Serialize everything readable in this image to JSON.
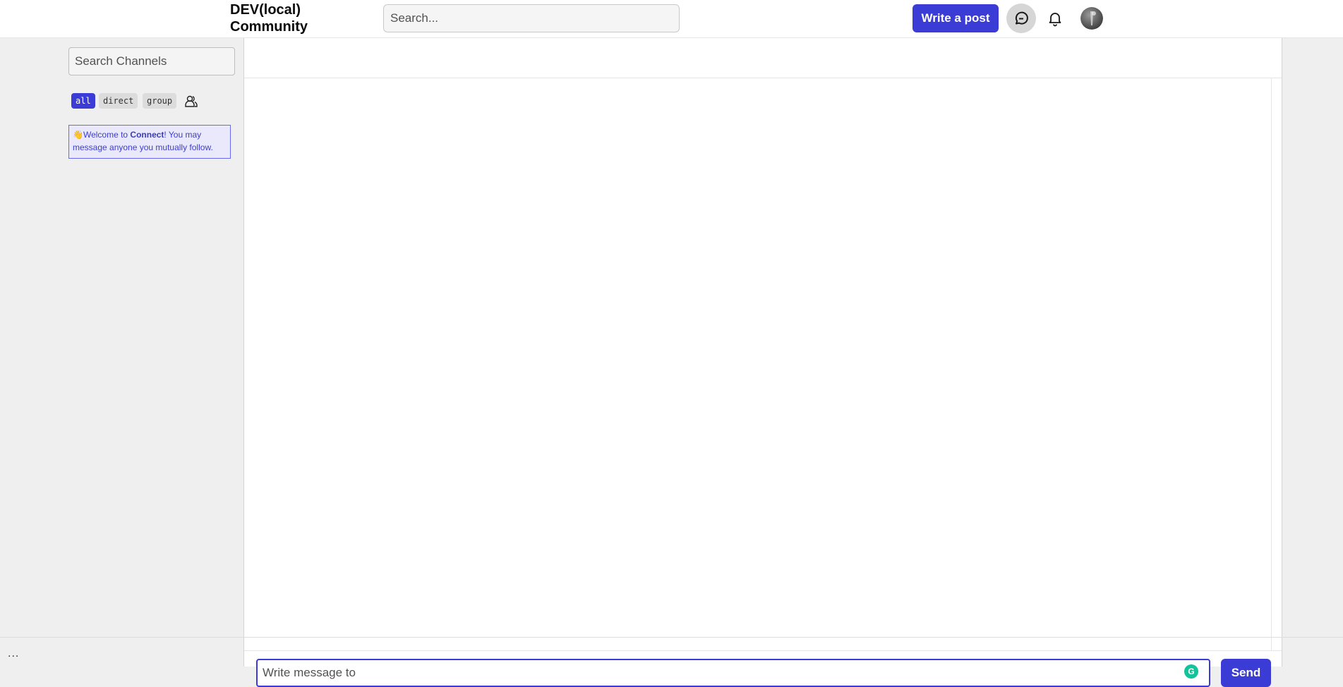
{
  "header": {
    "logo_text": "DEV(local) Community",
    "search_placeholder": "Search...",
    "write_post_label": "Write a post"
  },
  "sidebar": {
    "search_placeholder": "Search Channels",
    "filters": [
      "all",
      "direct",
      "group"
    ],
    "active_filter": "all",
    "welcome_prefix": "Welcome to ",
    "welcome_brand": "Connect",
    "welcome_suffix": "! You may message anyone you mutually follow."
  },
  "composer": {
    "placeholder": "Write message to",
    "send_label": "Send"
  },
  "footer": {
    "more_label": "..."
  },
  "colors": {
    "accent": "#3b3bd6",
    "background": "#efefef"
  }
}
